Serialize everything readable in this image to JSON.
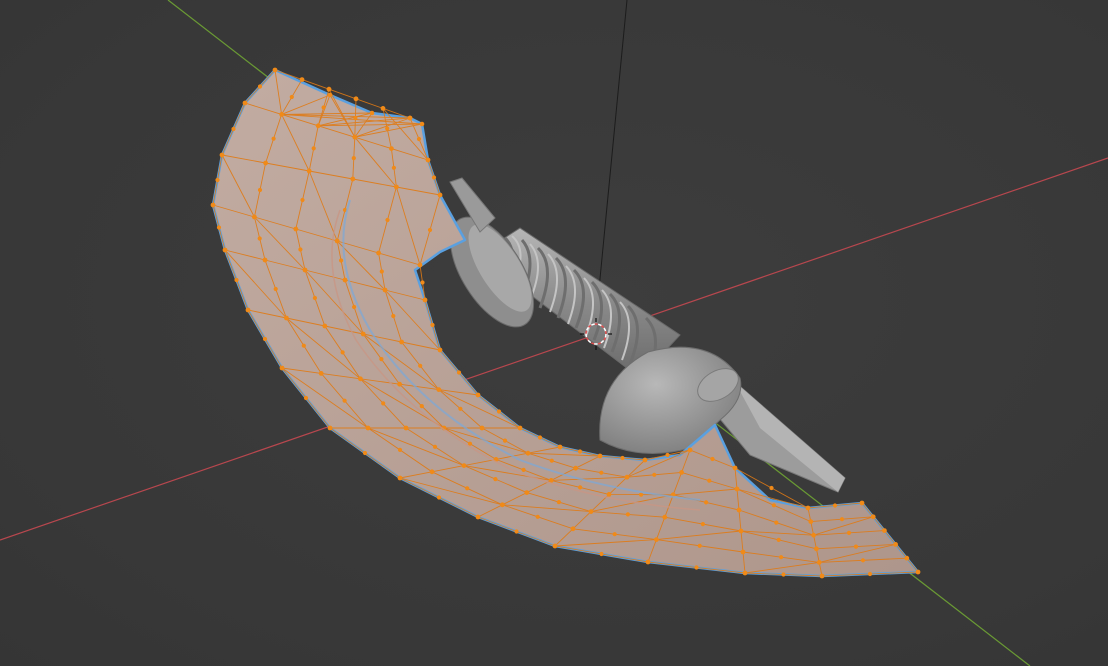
{
  "viewport": {
    "mode": "edit-mode",
    "colors": {
      "background": "#393939",
      "axis_x": "#b8474e",
      "axis_y": "#6a9a34",
      "axis_z": "#1a1a1a",
      "mesh_face": "#b9a39a",
      "mesh_edge": "#e07a14",
      "mesh_vertex": "#f08a18",
      "selection_outline": "#5aa0e0",
      "handle_mesh": "#9a9a9a",
      "cursor_red": "#e05050"
    },
    "objects": [
      {
        "name": "blade",
        "state": "selected-edit",
        "icon": "mesh"
      },
      {
        "name": "handle",
        "state": "unselected",
        "icon": "mesh"
      },
      {
        "name": "3d-cursor",
        "icon": "cursor"
      }
    ]
  }
}
